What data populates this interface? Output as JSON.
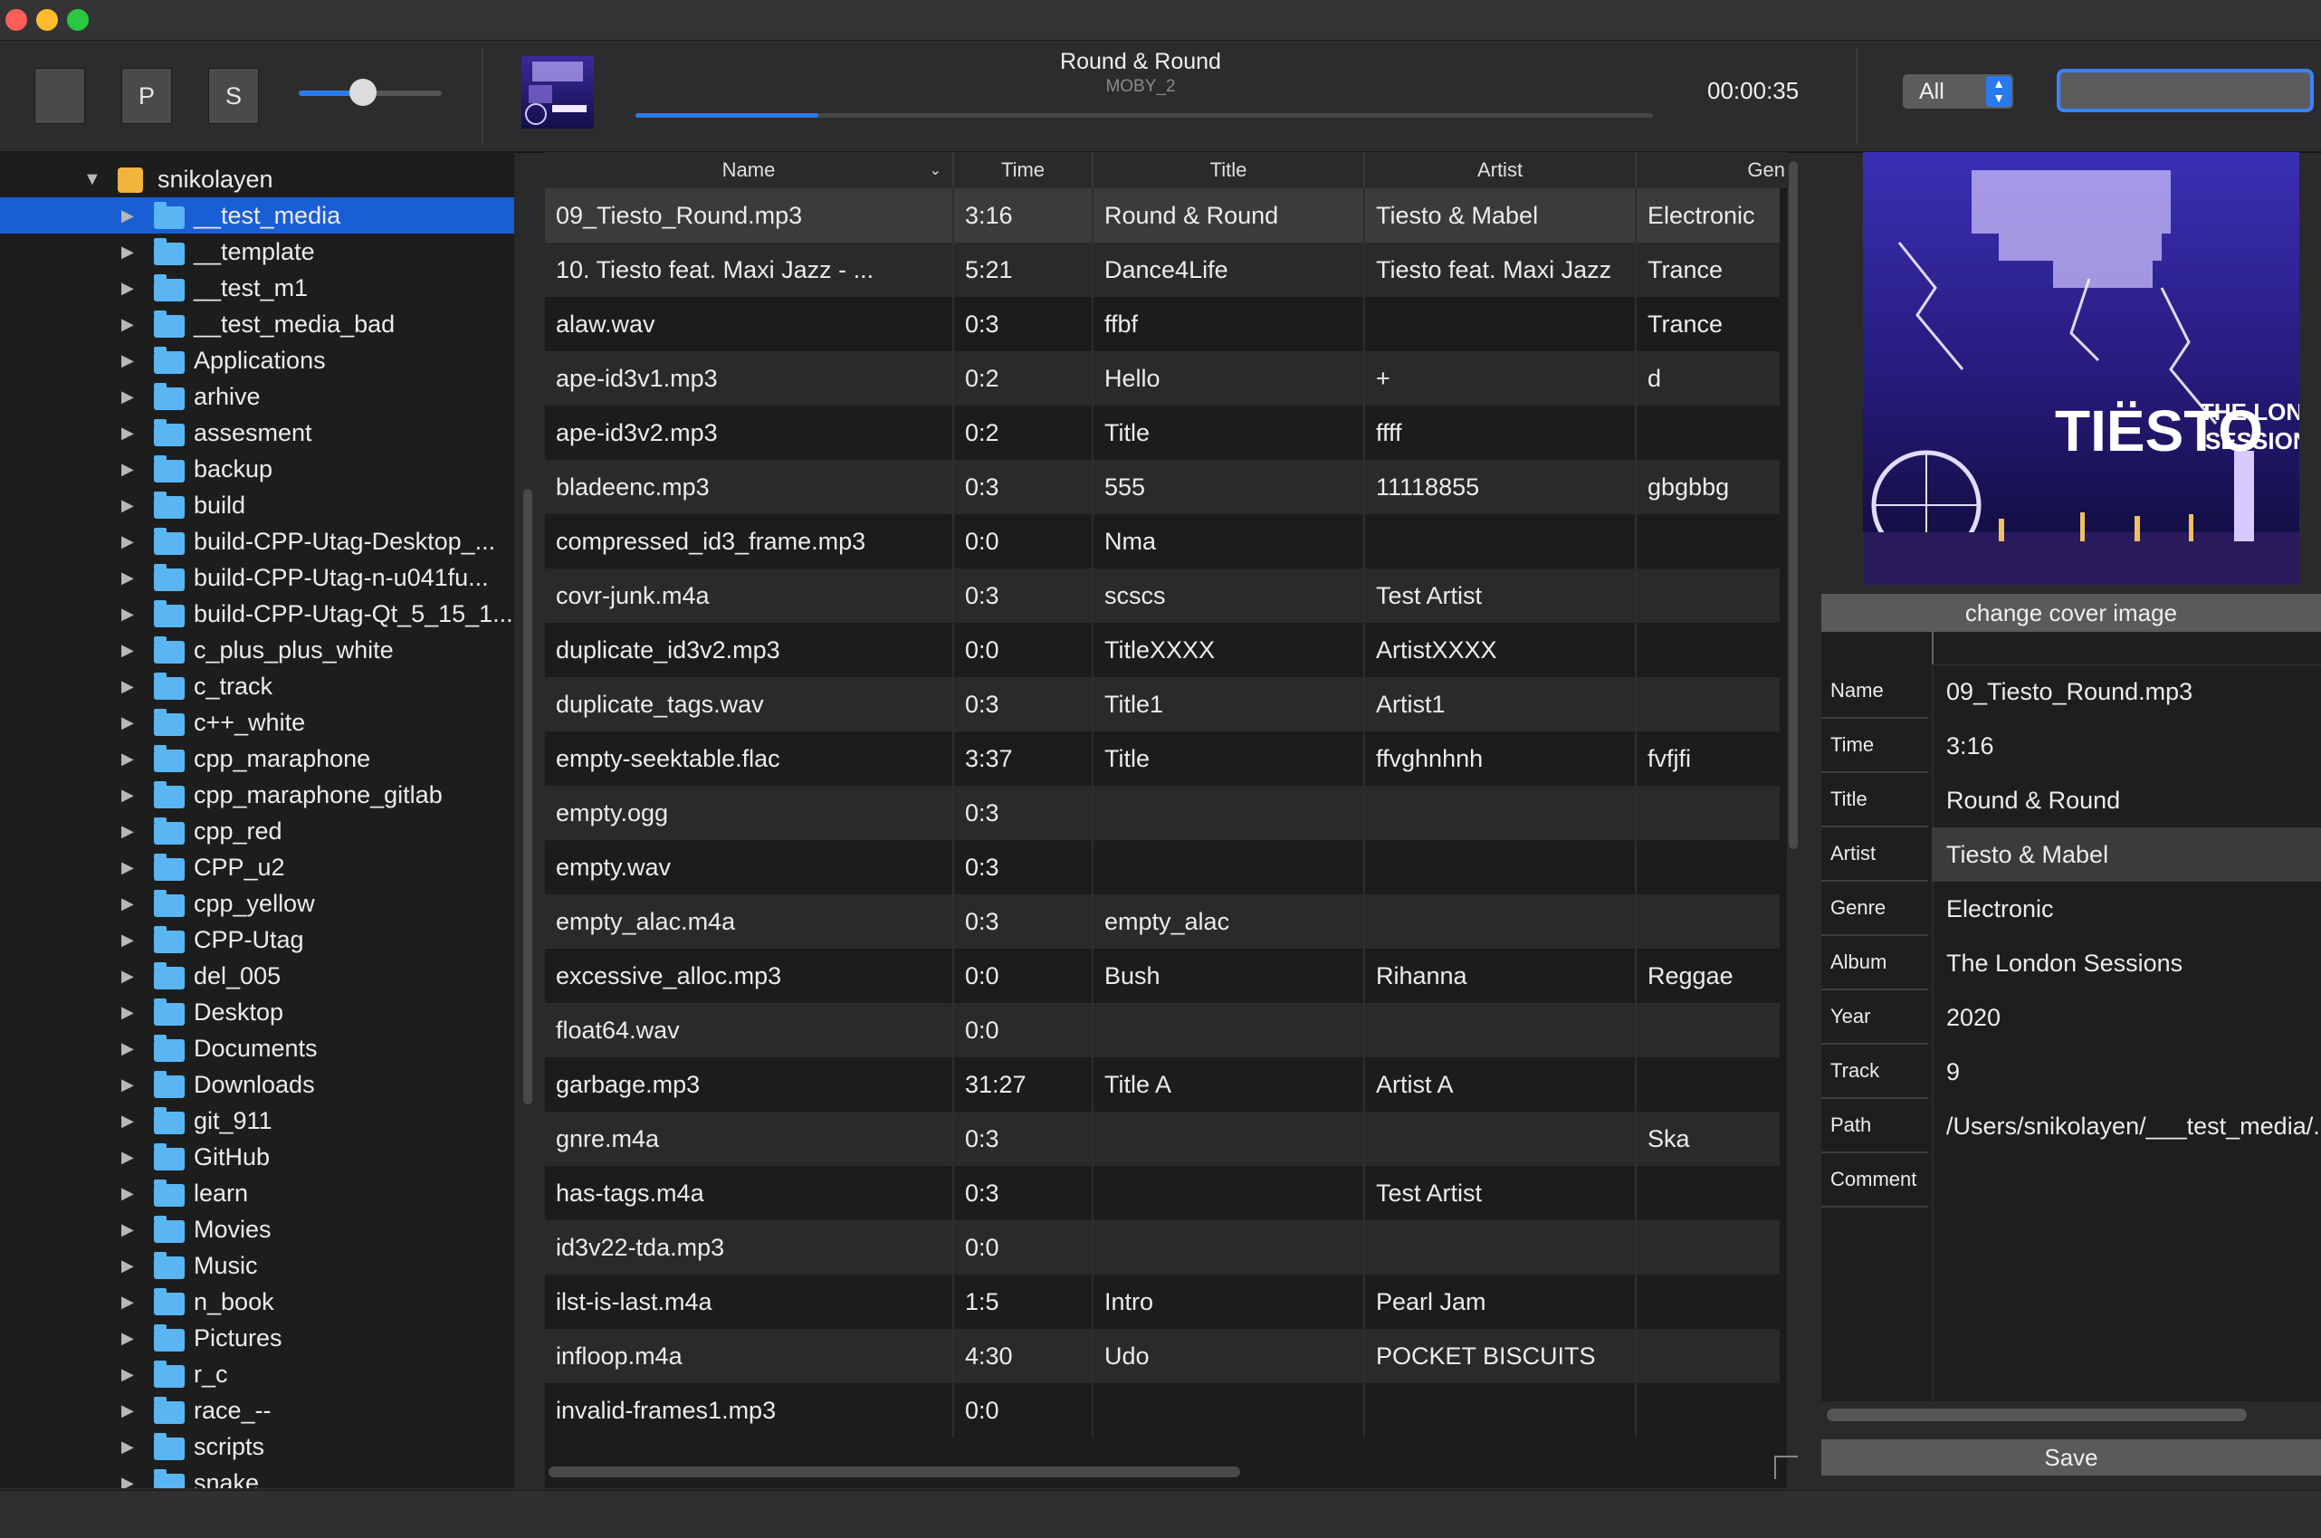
{
  "window": {
    "lights": [
      "#fe5f57",
      "#febc2e",
      "#28c840"
    ]
  },
  "toolbar": {
    "buttons": [
      "",
      "P",
      "S"
    ],
    "volume": 0.45,
    "now_playing": {
      "title": "Round & Round",
      "subtitle": "MOBY_2",
      "progress": 0.18,
      "time": "00:00:35"
    },
    "filter": {
      "value": "All"
    },
    "search": {
      "value": ""
    }
  },
  "sidebar": {
    "root": "snikolayen",
    "items": [
      "__test_media",
      "__template",
      "__test_m1",
      "__test_media_bad",
      "Applications",
      "arhive",
      "assesment",
      "backup",
      "build",
      "build-CPP-Utag-Desktop_...",
      "build-CPP-Utag-n-u041fu...",
      "build-CPP-Utag-Qt_5_15_1...",
      "c_plus_plus_white",
      "c_track",
      "c++_white",
      "cpp_maraphone",
      "cpp_maraphone_gitlab",
      "cpp_red",
      "CPP_u2",
      "cpp_yellow",
      "CPP-Utag",
      "del_005",
      "Desktop",
      "Documents",
      "Downloads",
      "git_911",
      "GitHub",
      "learn",
      "Movies",
      "Music",
      "n_book",
      "Pictures",
      "r_c",
      "race_--",
      "scripts",
      "snake"
    ],
    "selected": "__test_media"
  },
  "table": {
    "columns": [
      "Name",
      "Time",
      "Title",
      "Artist",
      "Gen"
    ],
    "rows": [
      [
        "09_Tiesto_Round.mp3",
        "3:16",
        "Round & Round",
        "Tiesto & Mabel",
        "Electronic"
      ],
      [
        "10. Tiesto feat. Maxi Jazz - ...",
        "5:21",
        "Dance4Life",
        "Tiesto feat. Maxi Jazz",
        "Trance"
      ],
      [
        "alaw.wav",
        "0:3",
        "ffbf",
        "",
        "Trance"
      ],
      [
        "ape-id3v1.mp3",
        "0:2",
        "Hello",
        "+",
        "d"
      ],
      [
        "ape-id3v2.mp3",
        "0:2",
        "Title",
        "ffff",
        ""
      ],
      [
        "bladeenc.mp3",
        "0:3",
        "555",
        "11118855",
        "gbgbbg"
      ],
      [
        "compressed_id3_frame.mp3",
        "0:0",
        "Nma",
        "",
        ""
      ],
      [
        "covr-junk.m4a",
        "0:3",
        "scscs",
        "Test Artist",
        ""
      ],
      [
        "duplicate_id3v2.mp3",
        "0:0",
        "TitleXXXX",
        "ArtistXXXX",
        ""
      ],
      [
        "duplicate_tags.wav",
        "0:3",
        "Title1",
        "Artist1",
        ""
      ],
      [
        "empty-seektable.flac",
        "3:37",
        "Title",
        "ffvghnhnh",
        "fvfjfi"
      ],
      [
        "empty.ogg",
        "0:3",
        "",
        "",
        ""
      ],
      [
        "empty.wav",
        "0:3",
        "",
        "",
        ""
      ],
      [
        "empty_alac.m4a",
        "0:3",
        "empty_alac",
        "",
        ""
      ],
      [
        "excessive_alloc.mp3",
        "0:0",
        "Bush",
        "Rihanna",
        "Reggae"
      ],
      [
        "float64.wav",
        "0:0",
        "",
        "",
        ""
      ],
      [
        "garbage.mp3",
        "31:27",
        "Title A",
        "Artist A",
        ""
      ],
      [
        "gnre.m4a",
        "0:3",
        "",
        "",
        "Ska"
      ],
      [
        "has-tags.m4a",
        "0:3",
        "",
        "Test Artist",
        ""
      ],
      [
        "id3v22-tda.mp3",
        "0:0",
        "",
        "",
        ""
      ],
      [
        "ilst-is-last.m4a",
        "1:5",
        "Intro",
        "Pearl Jam",
        ""
      ],
      [
        "infloop.m4a",
        "4:30",
        "Udo",
        "POCKET BISCUITS",
        ""
      ],
      [
        "invalid-frames1.mp3",
        "0:0",
        "",
        "",
        ""
      ]
    ],
    "selected_row": 0
  },
  "details": {
    "cover": {
      "line1": "TIËSTO",
      "line2": "THE LONDON",
      "line3": "SESSIONS"
    },
    "change_cover_label": "change cover image",
    "fields": [
      {
        "key": "Name",
        "value": "09_Tiesto_Round.mp3"
      },
      {
        "key": "Time",
        "value": "3:16"
      },
      {
        "key": "Title",
        "value": "Round & Round"
      },
      {
        "key": "Artist",
        "value": "Tiesto & Mabel"
      },
      {
        "key": "Genre",
        "value": "Electronic"
      },
      {
        "key": "Album",
        "value": "The London Sessions"
      },
      {
        "key": "Year",
        "value": "2020"
      },
      {
        "key": "Track",
        "value": "9"
      },
      {
        "key": "Path",
        "value": "/Users/snikolayen/___test_media/..."
      },
      {
        "key": "Comment",
        "value": ""
      }
    ],
    "selected_field": "Artist",
    "save_label": "Save"
  }
}
